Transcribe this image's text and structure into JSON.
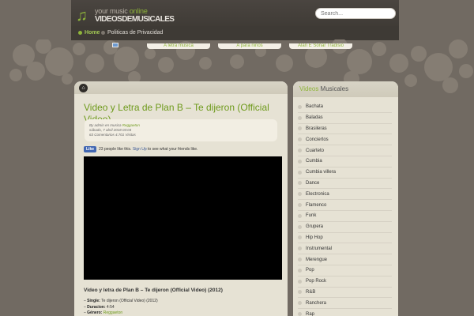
{
  "header": {
    "logo_line1_a": "your music ",
    "logo_line1_b": "online",
    "logo_line2": "VIDEOSDEMUSICALES",
    "search_placeholder": "Search...",
    "nav": [
      {
        "label": "Home"
      },
      {
        "label": "Politicas de Privacidad"
      }
    ],
    "link_tabs": [
      "A letra musica",
      "A para niños",
      "Alan E Sonar Tradisio"
    ],
    "accent_color": "#8fb53a"
  },
  "post": {
    "title": "Video y Letra de Plan B – Te dijeron (Official Video)",
    "meta_author_prefix": "By admin en musica",
    "meta_category": "Reggaeton",
    "meta_date": "sábado, 7 abril 2018 03:04",
    "meta_stats": "63 Comentarios 4.701 Visitas",
    "fb_like_label": "Like",
    "fb_text_a": "23 people like this.",
    "fb_signup": "Sign Up",
    "fb_text_b": "to see what your friends like.",
    "body_title": "Video y letra de Plan B – Te dijeron (Official Video) (2012)",
    "info": [
      {
        "key": "Single:",
        "value": "Te dijeron (Official Video) (2012)"
      },
      {
        "key": "Duracion:",
        "value": "4:54"
      },
      {
        "key": "Género:",
        "value": "Reggaeton"
      }
    ]
  },
  "sidebar": {
    "title_a": "Videos",
    "title_b": " Musicales",
    "items": [
      {
        "label": "Bachata"
      },
      {
        "label": "Baladas"
      },
      {
        "label": "Brasileras"
      },
      {
        "label": "Conciertos"
      },
      {
        "label": "Cuarteto"
      },
      {
        "label": "Cumbia"
      },
      {
        "label": "Cumbia villera"
      },
      {
        "label": "Dance"
      },
      {
        "label": "Electronica"
      },
      {
        "label": "Flamenco"
      },
      {
        "label": "Funk"
      },
      {
        "label": "Grupera"
      },
      {
        "label": "Hip Hop"
      },
      {
        "label": "Instrumental"
      },
      {
        "label": "Merengue"
      },
      {
        "label": "Pop"
      },
      {
        "label": "Pop Rock"
      },
      {
        "label": "R&B"
      },
      {
        "label": "Ranchera"
      },
      {
        "label": "Rap"
      }
    ]
  }
}
